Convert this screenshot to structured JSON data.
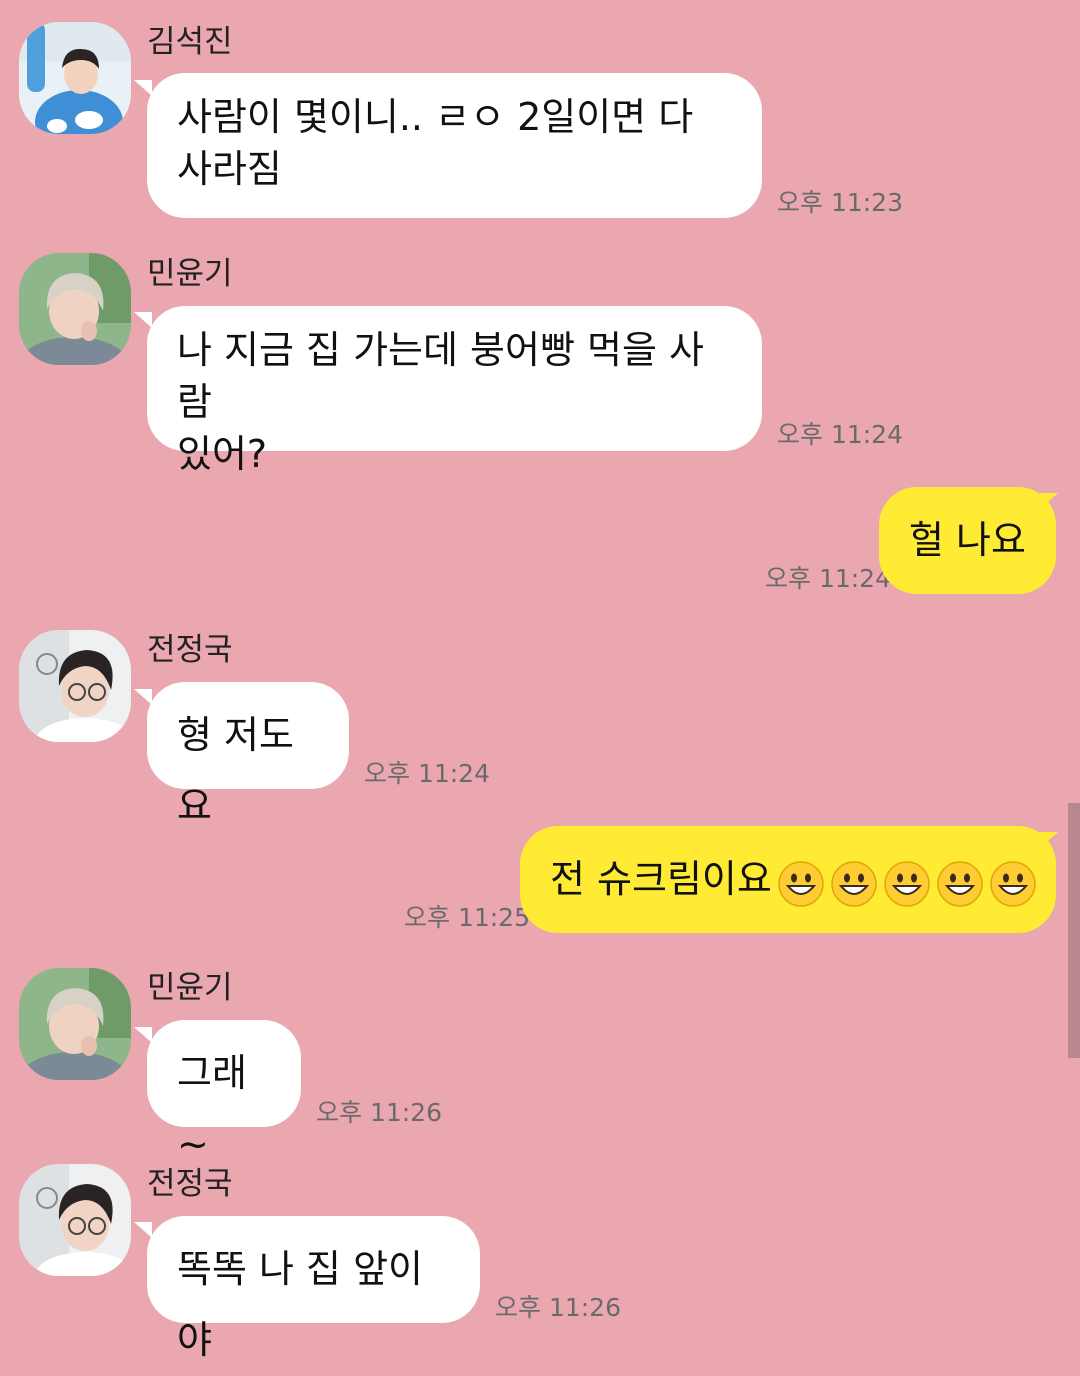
{
  "messages": [
    {
      "sender": "김석진",
      "text": "사람이 몇이니.. ㄹㅇ 2일이면 다\n사라짐",
      "time": "오후 11:23",
      "avatar_icon": "jin-profile-photo"
    },
    {
      "sender": "민윤기",
      "text": "나 지금 집 가는데 붕어빵 먹을 사람\n있어?",
      "time": "오후 11:24",
      "avatar_icon": "suga-profile-photo"
    },
    {
      "text": "헐 나요",
      "time": "오후 11:24"
    },
    {
      "sender": "전정국",
      "text": "형 저도요",
      "time": "오후 11:24",
      "avatar_icon": "jungkook-profile-photo"
    },
    {
      "text": "전 슈크림이요",
      "emoji_count": 5,
      "emoji_icon": "grinning-face-emoji",
      "time": "오후 11:25"
    },
    {
      "sender": "민윤기",
      "text": "그래~",
      "time": "오후 11:26",
      "avatar_icon": "suga-profile-photo"
    },
    {
      "sender": "전정국",
      "text": "똑똑 나 집 앞이야",
      "time": "오후 11:26",
      "avatar_icon": "jungkook-profile-photo"
    }
  ],
  "colors": {
    "background": "#eba7b0",
    "incoming_bubble": "#ffffff",
    "outgoing_bubble": "#ffeb33",
    "timestamp": "#6a6a6a"
  }
}
